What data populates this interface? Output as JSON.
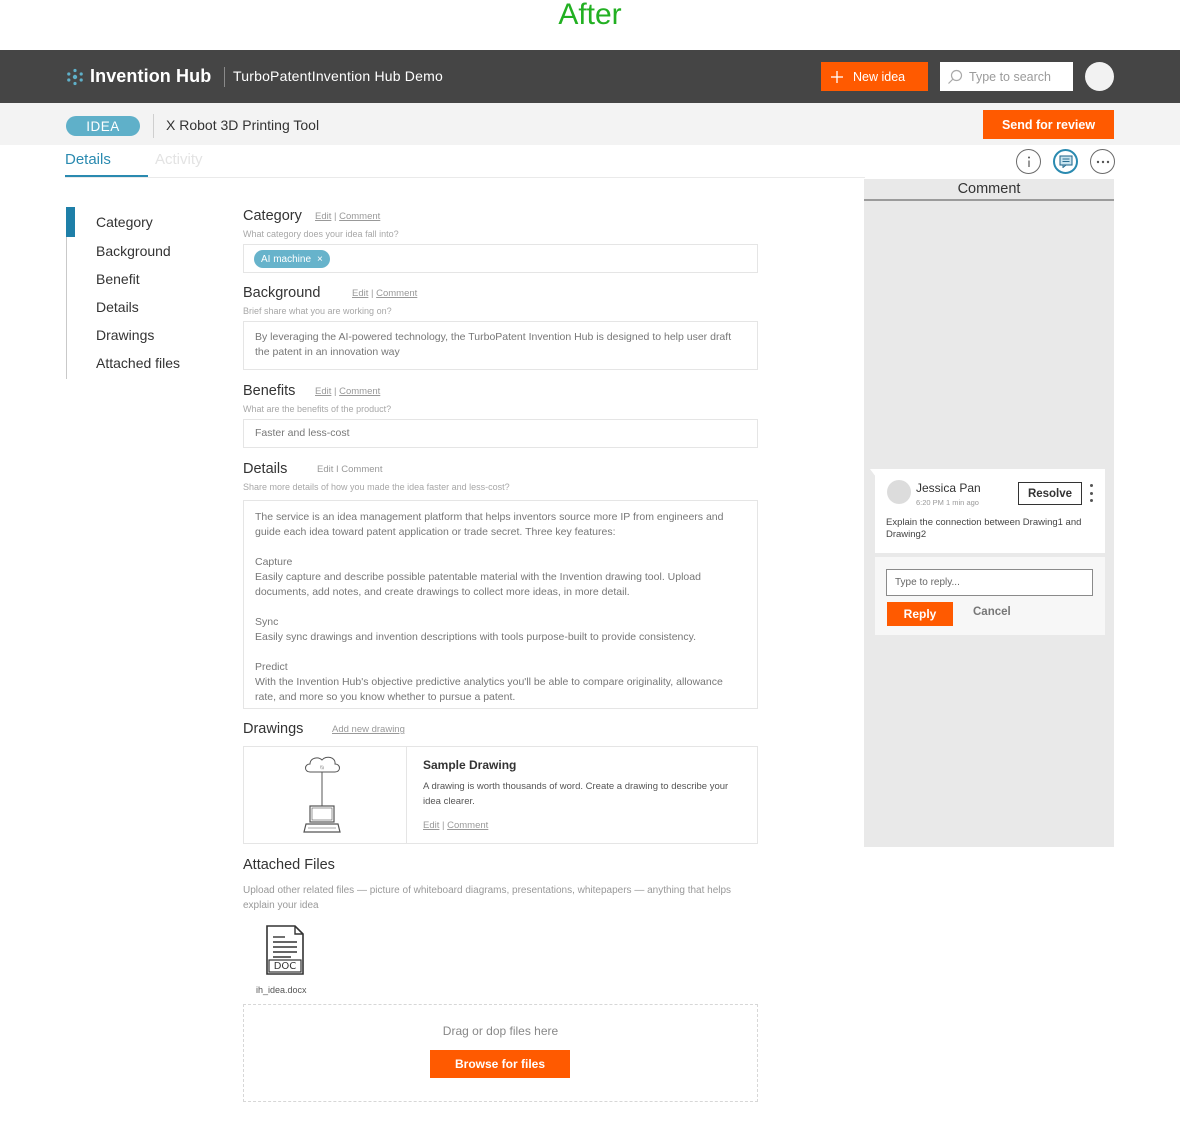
{
  "page_heading": "After",
  "topbar": {
    "logo_text": "Invention Hub",
    "workspace": "TurboPatentInvention Hub Demo",
    "new_idea_label": "New idea",
    "search_placeholder": "Type to search"
  },
  "subbar": {
    "badge": "IDEA",
    "title": "X Robot 3D Printing Tool",
    "send_label": "Send for review"
  },
  "tabs": {
    "details": "Details",
    "activity": "Activity"
  },
  "toolbar_icons": [
    "info-icon",
    "comment-icon",
    "more-icon"
  ],
  "nav": {
    "items": [
      "Category",
      "Background",
      "Benefit",
      "Details",
      "Drawings",
      "Attached files"
    ]
  },
  "links": {
    "edit": "Edit",
    "sep": "|",
    "comment": "Comment"
  },
  "sections": {
    "category": {
      "title": "Category",
      "hint": "What category does your idea fall into?",
      "chip": "AI machine",
      "chip_close": "×"
    },
    "background": {
      "title": "Background",
      "hint": "Brief share what you are working on?",
      "text": "By leveraging the AI-powered technology, the TurboPatent Invention Hub is designed to help user draft the patent in an innovation way"
    },
    "benefits": {
      "title": "Benefits",
      "hint": "What are the benefits of the product?",
      "text": "Faster and less-cost"
    },
    "details": {
      "title": "Details",
      "links_text": "Edit I Comment",
      "hint": "Share more details of how you made the idea faster and less-cost?",
      "intro": "The service is an idea management platform that helps inventors source more IP from engineers and guide each idea toward patent application or trade secret. Three key features:",
      "features": [
        {
          "name": "Capture",
          "desc": "Easily capture and describe possible patentable material with the Invention drawing tool. Upload documents, add notes, and create drawings to collect more ideas, in more detail."
        },
        {
          "name": "Sync",
          "desc": "Easily sync drawings and invention descriptions with tools purpose-built to provide consistency."
        },
        {
          "name": "Predict",
          "desc": "With the Invention Hub's objective predictive analytics you'll be able to compare originality, allowance rate, and more so you know whether to pursue a patent."
        }
      ]
    },
    "drawings": {
      "title": "Drawings",
      "add_link": "Add new drawing",
      "card_title": "Sample Drawing",
      "card_desc": "A drawing is worth thousands of word. Create a drawing to describe your idea clearer."
    },
    "files": {
      "title": "Attached Files",
      "hint": "Upload other related files — picture of whiteboard diagrams, presentations, whitepapers — anything that helps explain your idea",
      "file_badge": "DOC",
      "file_name": "ih_idea.docx",
      "drop_text": "Drag or dop files here",
      "browse_label": "Browse for files"
    }
  },
  "comment_panel": {
    "title": "Comment",
    "author": "Jessica Pan",
    "time": "6:20 PM  1 min ago",
    "resolve_label": "Resolve",
    "body": "Explain the connection between Drawing1 and Drawing2",
    "reply_placeholder": "Type to reply...",
    "reply_label": "Reply",
    "cancel_label": "Cancel"
  },
  "colors": {
    "accent": "#ff5a00",
    "topbar": "#454545",
    "link_blue": "#2a8ab0",
    "heading_green": "#22b022"
  }
}
